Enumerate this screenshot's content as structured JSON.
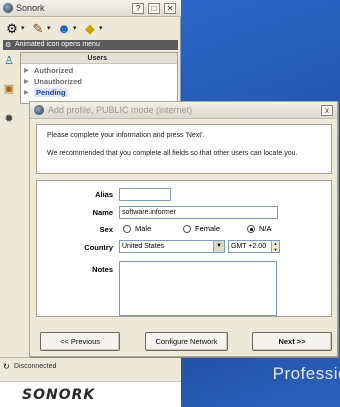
{
  "main_window": {
    "title": "Sonork",
    "titlebar_buttons": [
      "?",
      "□",
      "✕"
    ],
    "banner_text": "Animated icon opens menu",
    "users_header": "Users",
    "groups": [
      {
        "label": "Authorized",
        "active": false
      },
      {
        "label": "Unauthorized",
        "active": false
      },
      {
        "label": "Pending",
        "active": true
      }
    ],
    "status_text": "Disconnected",
    "logo_text": "SONORK"
  },
  "desktop": {
    "brand_text": "Professio"
  },
  "dialog": {
    "title": "Add profile, PUBLIC mode (internet)",
    "close_label": "x",
    "intro_line1": "Please complete your information and press 'Next'.",
    "intro_line2": "We recommended that you complete all fields so that other users can locate you.",
    "labels": {
      "alias": "Alias",
      "name": "Name",
      "sex": "Sex",
      "country": "Country",
      "notes": "Notes"
    },
    "values": {
      "alias": "",
      "name": "software.informer",
      "country": "United States",
      "timezone": "GMT +2.00",
      "notes": ""
    },
    "sex_options": [
      {
        "label": "Male",
        "selected": false
      },
      {
        "label": "Female",
        "selected": false
      },
      {
        "label": "N/A",
        "selected": true
      }
    ],
    "buttons": {
      "previous": "<< Previous",
      "configure": "Configure Network",
      "next": "Next >>"
    }
  }
}
